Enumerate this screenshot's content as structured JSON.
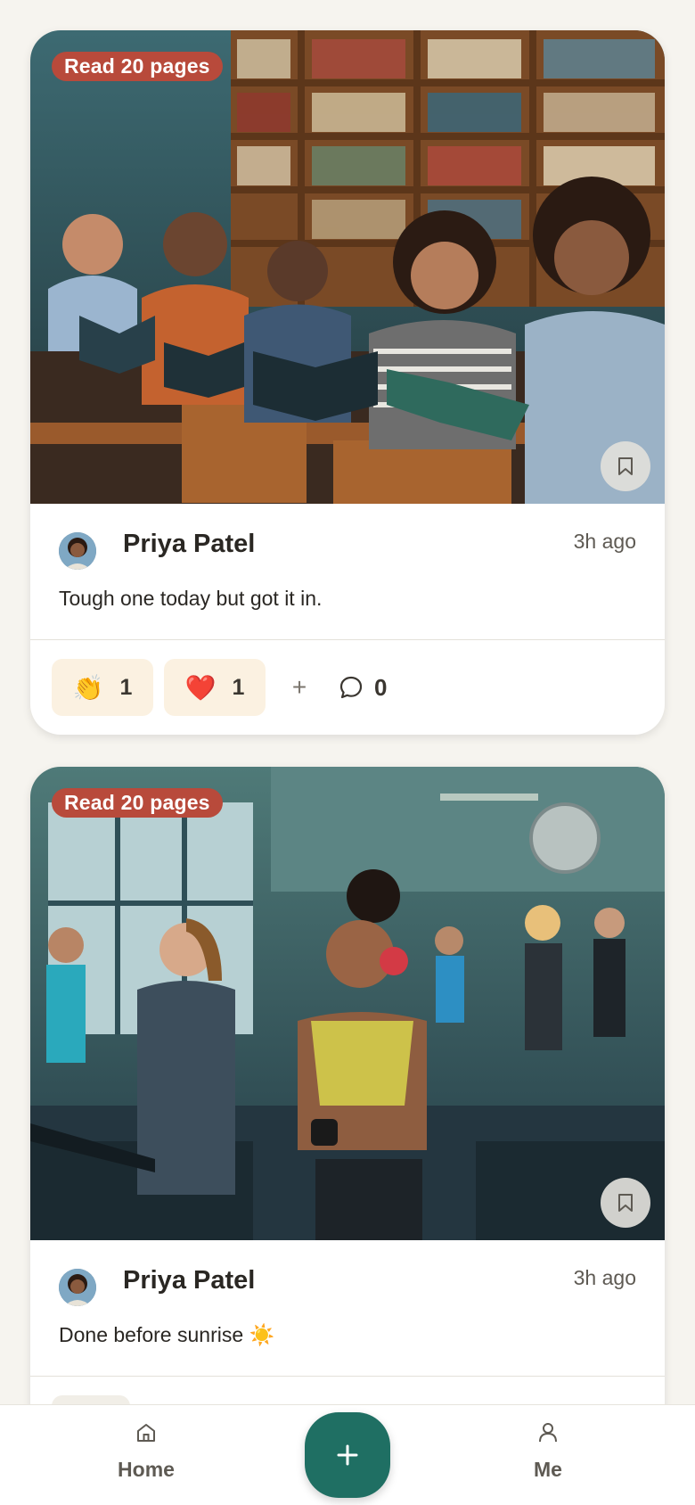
{
  "feed": {
    "posts": [
      {
        "badge": "Read 20 pages",
        "photo_scene": "library-readers",
        "author": "Priya Patel",
        "time": "3h ago",
        "caption": "Tough one today but got it in.",
        "reactions": [
          {
            "emoji": "👏",
            "count": "1"
          },
          {
            "emoji": "❤️",
            "count": "1"
          }
        ],
        "add_reaction_label": "+",
        "comment_count": "0"
      },
      {
        "badge": "Read 20 pages",
        "photo_scene": "gym-treadmill-runners",
        "author": "Priya Patel",
        "time": "3h ago",
        "caption": "Done before sunrise ☀️"
      }
    ]
  },
  "nav": {
    "home_label": "Home",
    "me_label": "Me",
    "add_label": "+"
  },
  "colors": {
    "badge": "#b84a3b",
    "fab": "#1f6f63",
    "reaction_bg": "#fbf1e1",
    "background": "#f6f4ef"
  }
}
